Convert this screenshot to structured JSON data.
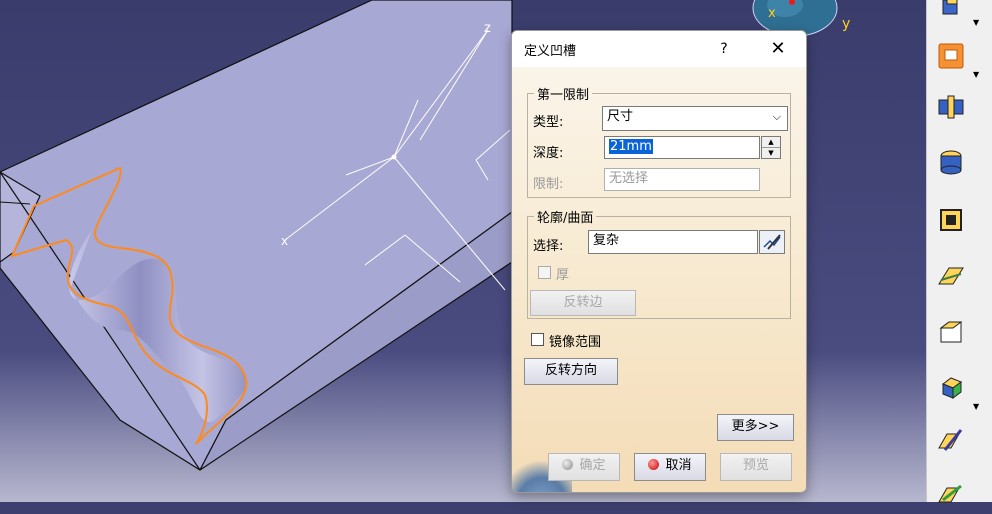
{
  "viewport": {
    "axis_z_label": "z",
    "axis_y_label": "y",
    "axis_x_label": "x"
  },
  "dialog": {
    "title": "定义凹槽",
    "help_label": "?",
    "close_label": "✕",
    "first_limit": {
      "legend": "第一限制",
      "type_label": "类型:",
      "type_value": "尺寸",
      "depth_label": "深度:",
      "depth_value": "21mm",
      "limit_label": "限制:",
      "limit_placeholder": "无选择"
    },
    "profile": {
      "legend": "轮廓/曲面",
      "select_label": "选择:",
      "select_value": "复杂",
      "thick_label": "厚",
      "thick_checked": false,
      "reverse_side_label": "反转边"
    },
    "mirror_label": "镜像范围",
    "mirror_checked": false,
    "reverse_dir_label": "反转方向",
    "more_label": "更多>>",
    "ok_label": "确定",
    "cancel_label": "取消",
    "preview_label": "预览"
  },
  "toolbar": {
    "icons": [
      "solid-combine-icon",
      "pocket-icon",
      "hole-icon",
      "groove-cylinder-icon",
      "shell-box-icon",
      "draft-icon",
      "chamfer-icon",
      "body-cube-icon",
      "edit-feature-icon",
      "hatch-icon"
    ]
  }
}
